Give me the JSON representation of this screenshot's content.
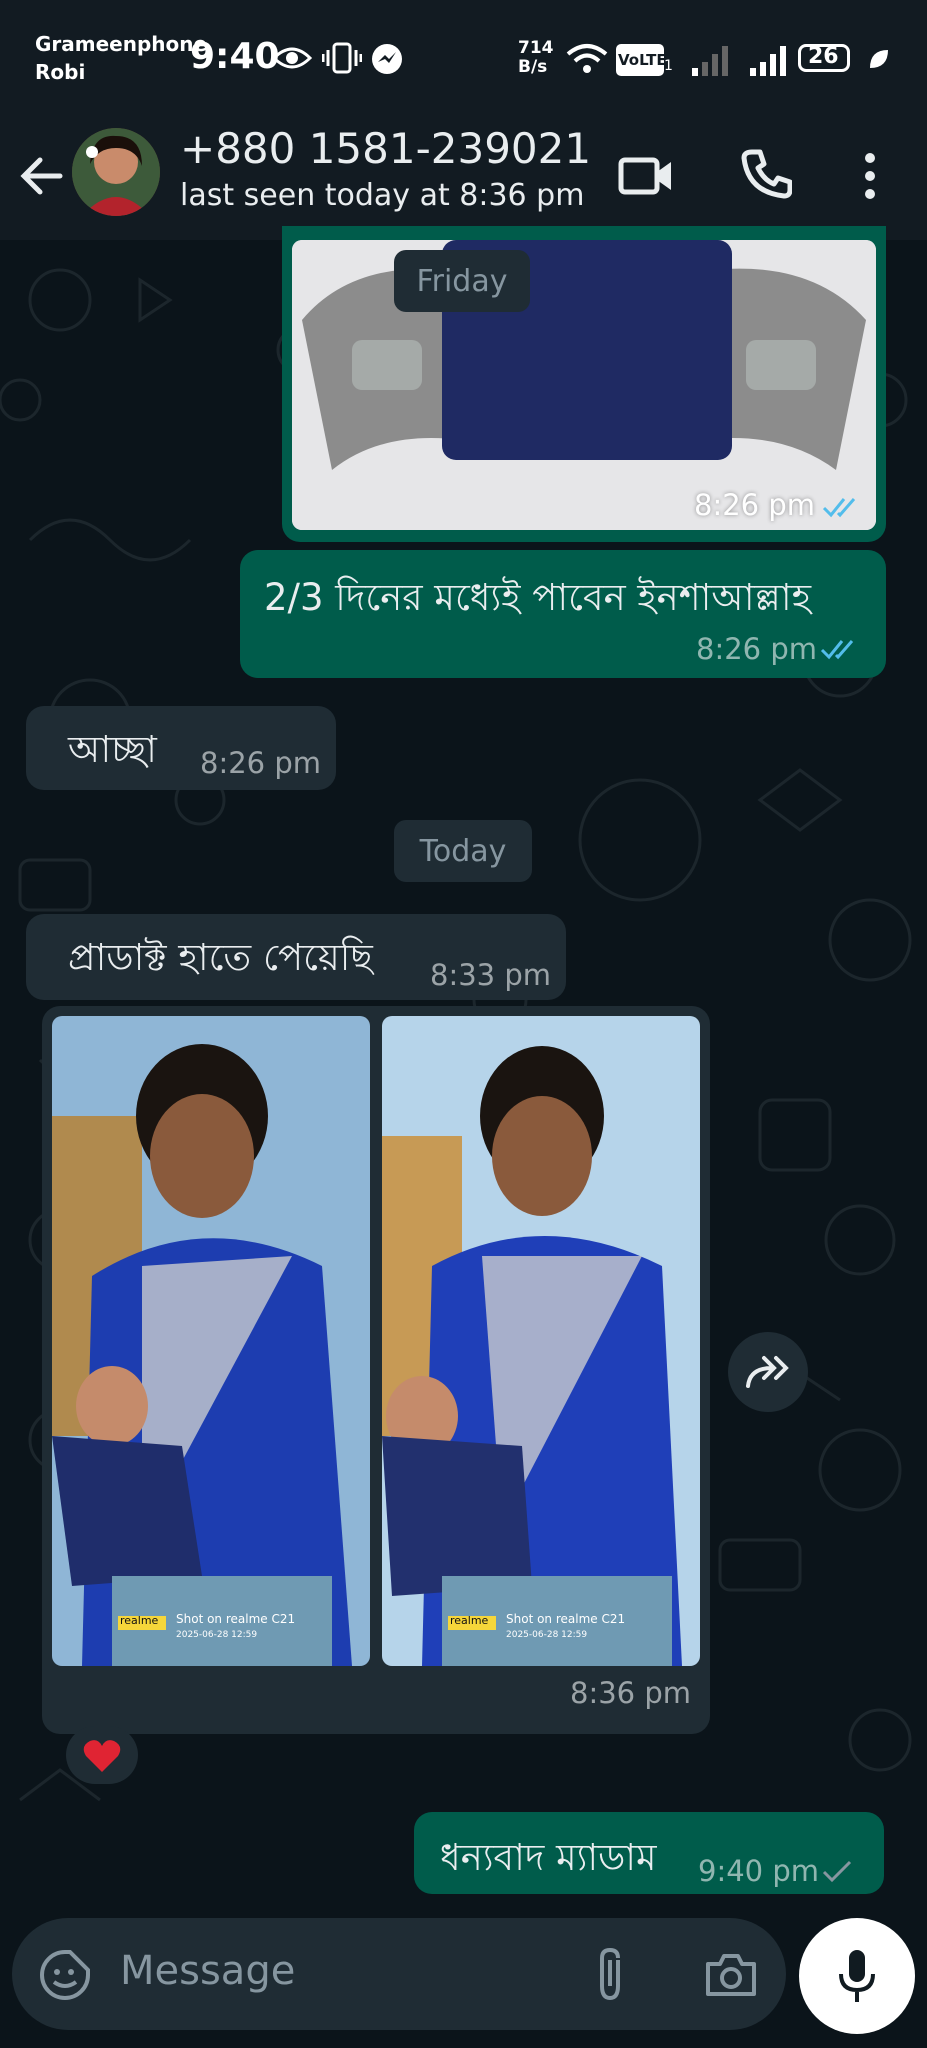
{
  "status_bar": {
    "carrier_1": "Grameenphone",
    "carrier_2": "Robi",
    "time": "9:40",
    "net_speed_value": "714",
    "net_speed_unit": "B/s",
    "volte": "VoLTE",
    "sim_index": "1",
    "battery": "26"
  },
  "header": {
    "contact_name": "+880 1581-239021",
    "last_seen": "last seen today at 8:36 pm"
  },
  "conversation": {
    "date_chip_friday": "Friday",
    "image_msg_time": "8:26 pm",
    "msg_out_1": {
      "text": "2/3 দিনের মধ্যেই পাবেন ইনশাআল্লাহ",
      "time": "8:26 pm"
    },
    "msg_in_1": {
      "text": "আচ্ছা",
      "time": "8:26 pm"
    },
    "date_chip_today": "Today",
    "msg_in_2": {
      "text": "প্রাডাক্ট হাতে পেয়েছি",
      "time": "8:33 pm"
    },
    "photo_1_watermark": "Shot on realme C21",
    "photo_1_date": "2025-06-28 12:59",
    "photo_2_watermark": "Shot on realme C21",
    "photo_2_date": "2025-06-28 12:59",
    "watermark_brand": "realme",
    "photos_time": "8:36 pm",
    "reaction": "❤️",
    "msg_out_2": {
      "text": "ধন্যবাদ ম্যাডাম",
      "time": "9:40 pm"
    }
  },
  "input": {
    "placeholder": "Message"
  },
  "colors": {
    "header_bg": "#121b22",
    "chat_bg": "#0b141a",
    "outgoing_bubble": "#005c4b",
    "incoming_bubble": "#1f2c34",
    "read_tick": "#53bdeb"
  },
  "icons": [
    "back-arrow-icon",
    "video-call-icon",
    "phone-call-icon",
    "more-options-icon",
    "forward-icon",
    "sticker-icon",
    "attach-icon",
    "camera-icon",
    "mic-icon",
    "eye-icon",
    "vibrate-icon",
    "messenger-icon",
    "wifi-icon",
    "signal-icon",
    "battery-icon"
  ]
}
